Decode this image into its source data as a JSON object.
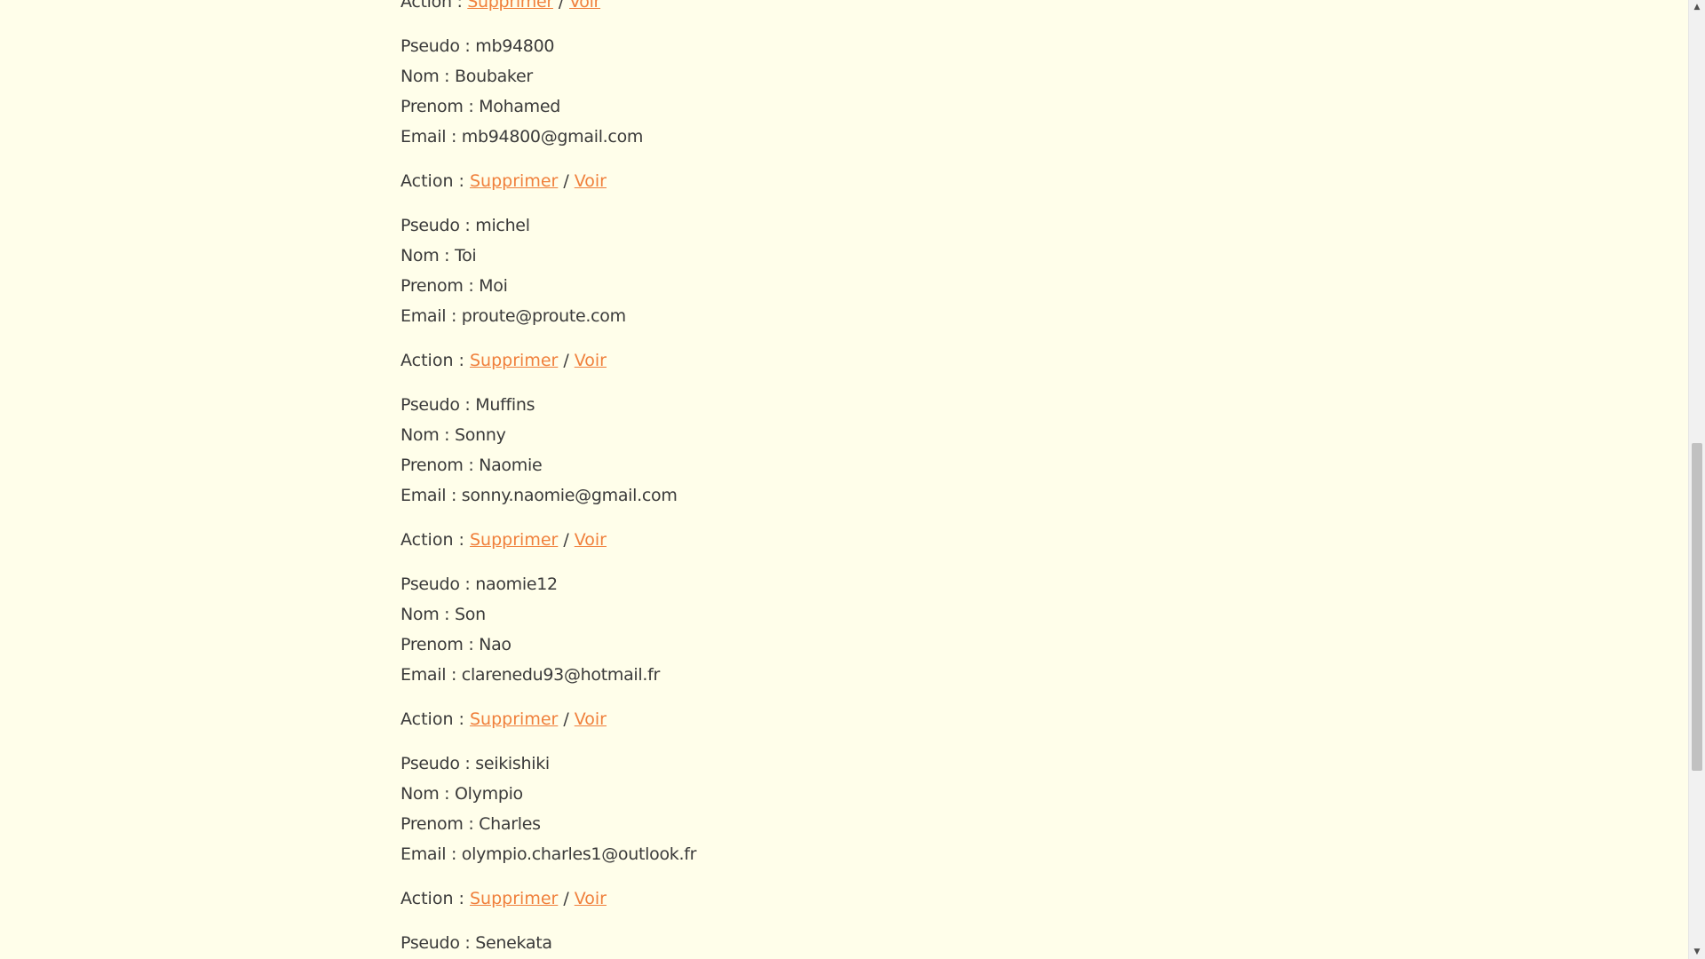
{
  "labels": {
    "pseudo": "Pseudo : ",
    "nom": "Nom : ",
    "prenom": "Prenom : ",
    "email": "Email : ",
    "action": "Action : ",
    "delete": "Supprimer",
    "separator": "/",
    "view": "Voir"
  },
  "users": [
    {
      "pseudo": "mb94800",
      "nom": "Boubaker",
      "prenom": "Mohamed",
      "email": "mb94800@gmail.com"
    },
    {
      "pseudo": "michel",
      "nom": "Toi",
      "prenom": "Moi",
      "email": "proute@proute.com"
    },
    {
      "pseudo": "Muffins",
      "nom": "Sonny",
      "prenom": "Naomie",
      "email": "sonny.naomie@gmail.com"
    },
    {
      "pseudo": "naomie12",
      "nom": "Son",
      "prenom": "Nao",
      "email": "clarenedu93@hotmail.fr"
    },
    {
      "pseudo": "seikishiki",
      "nom": "Olympio",
      "prenom": "Charles",
      "email": "olympio.charles1@outlook.fr"
    },
    {
      "pseudo": "Senekata"
    }
  ],
  "scrollbar": {
    "up_icon": "▲",
    "down_icon": "▼",
    "position": 0.68
  }
}
